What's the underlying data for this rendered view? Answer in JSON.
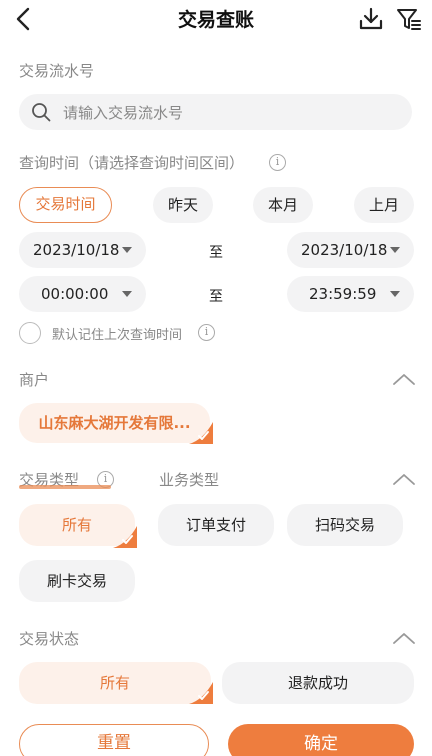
{
  "header": {
    "title": "交易查账"
  },
  "serial": {
    "label": "交易流水号",
    "placeholder": "请输入交易流水号"
  },
  "query_time": {
    "label": "查询时间（请选择查询时间区间）",
    "quick_options": [
      "交易时间",
      "昨天",
      "本月",
      "上月"
    ],
    "selected_option": "交易时间",
    "start_date": "2023/10/18",
    "end_date": "2023/10/18",
    "start_time": "00:00:00",
    "end_time": "23:59:59",
    "to_label": "至",
    "remember_label": "默认记住上次查询时间",
    "remember_checked": false
  },
  "merchant": {
    "label": "商户",
    "selected": "山东麻大湖开发有限..."
  },
  "type_tabs": {
    "tabs": [
      "交易类型",
      "业务类型"
    ],
    "active": "交易类型"
  },
  "transaction_types": {
    "options": [
      "所有",
      "订单支付",
      "扫码交易",
      "刷卡交易"
    ],
    "selected": "所有"
  },
  "status": {
    "label": "交易状态",
    "options": [
      "所有",
      "退款成功"
    ],
    "selected": "所有"
  },
  "footer": {
    "reset_label": "重置",
    "confirm_label": "确定"
  },
  "colors": {
    "accent": "#ee7d3e",
    "accent_light": "#fdf1ea",
    "gray_bg": "#f3f3f4"
  },
  "icons": [
    "back-arrow-icon",
    "download-icon",
    "filter-icon",
    "search-icon",
    "info-icon",
    "chevron-up-icon",
    "check-icon"
  ]
}
